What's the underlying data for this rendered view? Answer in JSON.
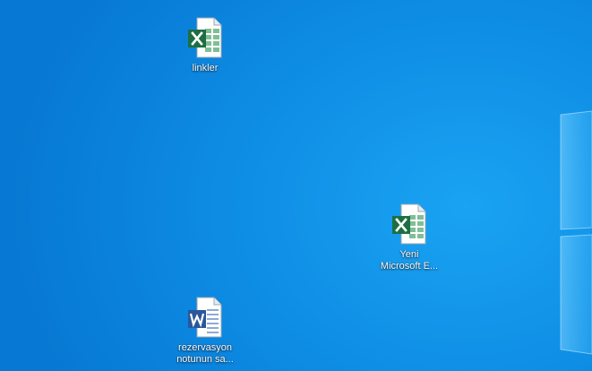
{
  "desktop": {
    "icons": [
      {
        "type": "excel",
        "icon": "excel-file-icon",
        "lines": [
          "linkler"
        ]
      },
      {
        "type": "excel",
        "icon": "excel-file-icon",
        "lines": [
          "Yeni",
          "Microsoft E..."
        ]
      },
      {
        "type": "word",
        "icon": "word-file-icon",
        "lines": [
          "rezervasyon",
          "notunun sa..."
        ]
      }
    ]
  },
  "colors": {
    "excel": "#1d6f42",
    "word": "#2b579a",
    "desktop": "#0f8fe6"
  }
}
